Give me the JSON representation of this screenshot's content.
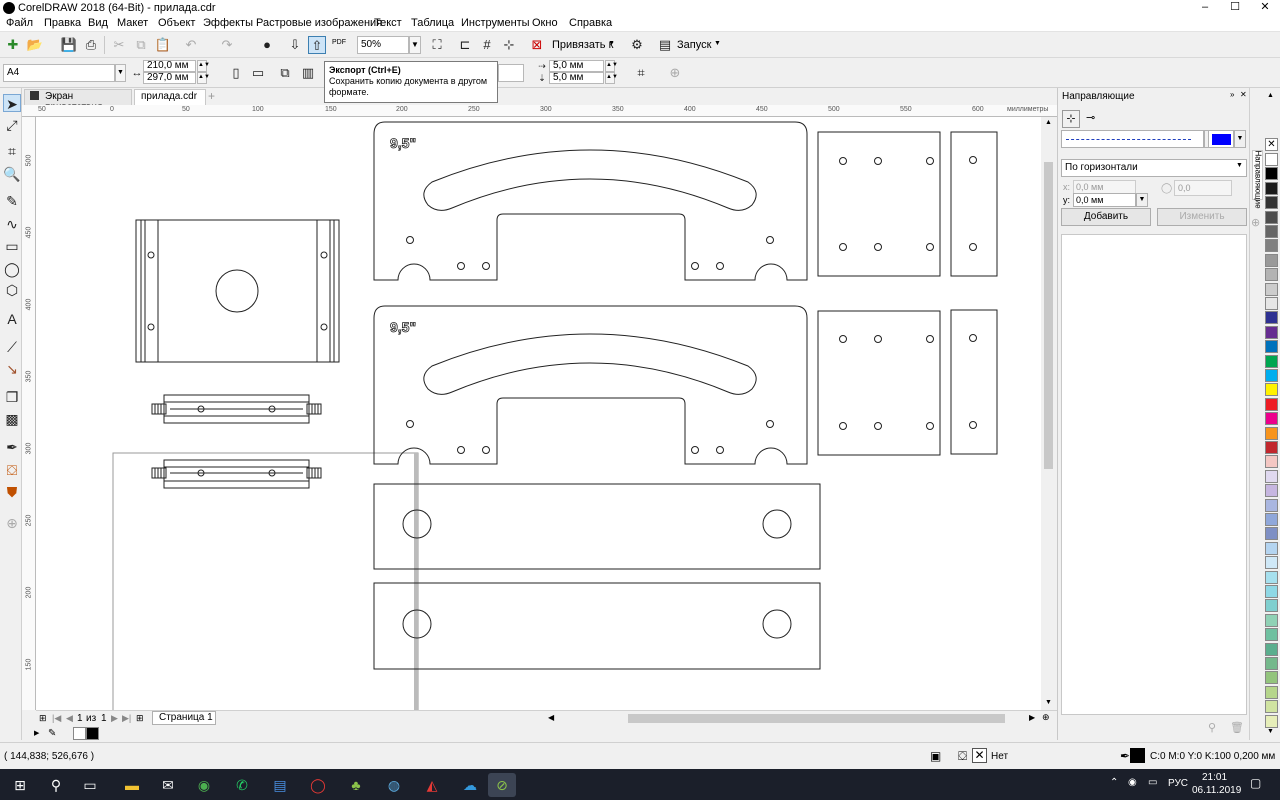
{
  "window": {
    "title": "CorelDRAW 2018 (64-Bit) - прилада.cdr",
    "minimize": "–",
    "maximize": "☐",
    "close": "✕"
  },
  "menu": [
    "Файл",
    "Правка",
    "Вид",
    "Макет",
    "Объект",
    "Эффекты",
    "Растровые изображения",
    "Текст",
    "Таблица",
    "Инструменты",
    "Окно",
    "Справка"
  ],
  "toolbar": {
    "zoom_value": "50%",
    "snap_label": "Привязать к",
    "launch_label": "Запуск",
    "pdf_label": "PDF"
  },
  "propbar": {
    "page_size": "A4",
    "width": "210,0 мм",
    "height": "297,0 мм",
    "dup_x": "5,0 мм",
    "dup_y": "5,0 мм"
  },
  "tooltip": {
    "title": "Экспорт (Ctrl+E)",
    "body": "Сохранить копию документа в другом формате."
  },
  "tabs": [
    {
      "label": "Экран приветствия",
      "active": false
    },
    {
      "label": "прилада.cdr",
      "active": true
    }
  ],
  "ruler": {
    "h_ticks": [
      "50",
      "0",
      "50",
      "100",
      "150",
      "200",
      "250",
      "300",
      "350",
      "400",
      "450",
      "500",
      "550",
      "600"
    ],
    "h_units": "миллиметры",
    "v_ticks": [
      "500",
      "450",
      "400",
      "350",
      "300",
      "250",
      "200",
      "150"
    ]
  },
  "canvas": {
    "engrave_text": "9,5\""
  },
  "pages": {
    "current": "1",
    "of_label": "из",
    "total": "1",
    "page_tab": "Страница 1"
  },
  "docker": {
    "title": "Направляющие",
    "vertical_tab": "Направляющие",
    "orientation": "По горизонтали",
    "x_label": "x:",
    "x_value": "0,0 мм",
    "y_label": "y:",
    "y_value": "0,0 мм",
    "angle_value": "0,0",
    "add_button": "Добавить",
    "change_button": "Изменить",
    "line_color": "#0000ff"
  },
  "palette": [
    "#ffffff",
    "#000000",
    "#1a1a1a",
    "#333333",
    "#4d4d4d",
    "#666666",
    "#808080",
    "#999999",
    "#b3b3b3",
    "#cccccc",
    "#e6e6e6",
    "#2e3192",
    "#662d91",
    "#0072bc",
    "#00a651",
    "#00aeef",
    "#fff200",
    "#ed1c24",
    "#ec008c",
    "#f7941d",
    "#c1272d",
    "#f4c7c3",
    "#e0d9f0",
    "#c6b6e0",
    "#a9b6e0",
    "#8fa7da",
    "#7e8fc4",
    "#b4d4f0",
    "#cfe8f7",
    "#a6e0ee",
    "#8fd8e5",
    "#7fcfcf",
    "#8fd1b5",
    "#6fc0a0",
    "#5bae8e",
    "#74b88b",
    "#93c47d",
    "#b5d58b",
    "#d0e3a1",
    "#e6eeb9"
  ],
  "status": {
    "coords": "( 144,838; 526,676 )",
    "fill_label": "Нет",
    "outline": "C:0 M:0 Y:0 K:100  0,200 мм"
  },
  "taskbar": {
    "lang": "РУС",
    "time": "21:01",
    "date": "06.11.2019"
  }
}
